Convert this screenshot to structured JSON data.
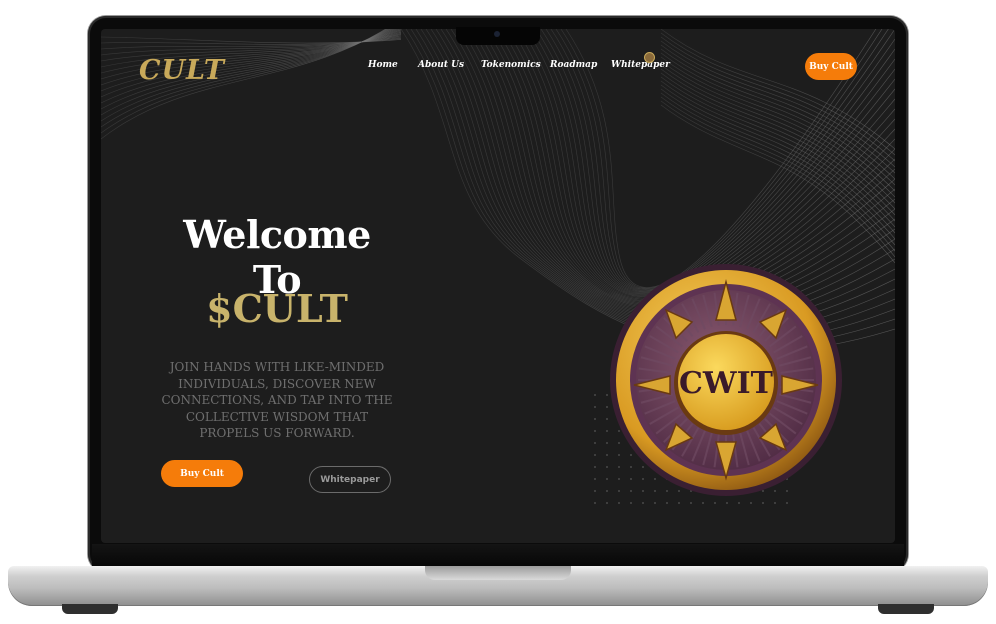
{
  "site": {
    "logo": "CULT",
    "nav": [
      "Home",
      "About Us",
      "Tokenomics",
      "Roadmap",
      "Whitepaper"
    ],
    "buy_button": "Buy Cult"
  },
  "hero": {
    "title": "Welcome To",
    "ticker": "$CULT",
    "description": "JOIN HANDS WITH LIKE-MINDED INDIVIDUALS, DISCOVER NEW CONNECTIONS, AND TAP INTO THE COLLECTIVE WISDOM THAT PROPELS US FORWARD.",
    "buy_button": "Buy Cult",
    "whitepaper_button": "Whitepaper"
  },
  "coin": {
    "label": "CWIT"
  },
  "colors": {
    "accent": "#f57c0a",
    "gold": "#c8a95a",
    "background": "#1d1d1d"
  }
}
